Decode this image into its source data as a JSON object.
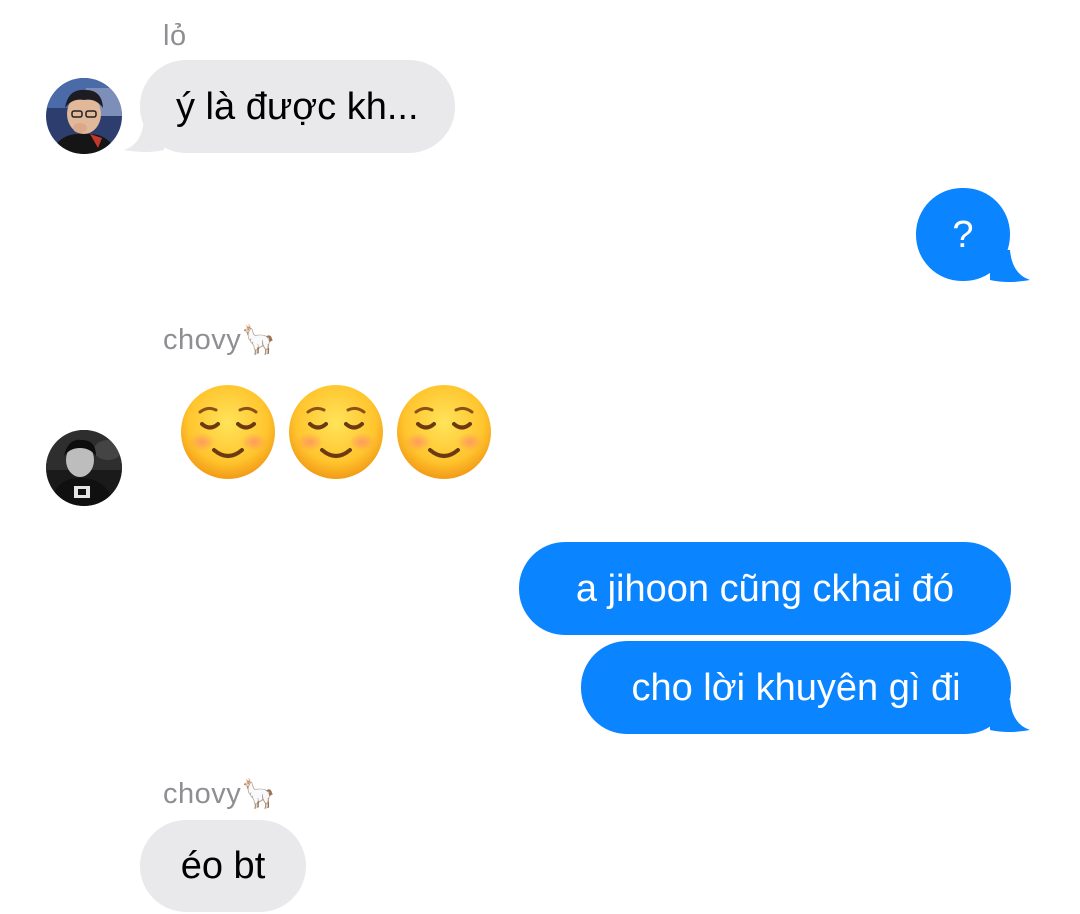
{
  "colors": {
    "incoming_bubble": "#e9e9eb",
    "outgoing_bubble": "#0a84ff",
    "sender_name": "#8e8e93"
  },
  "messages": [
    {
      "direction": "incoming",
      "sender": "lỏ",
      "text": "ý là được kh...",
      "avatar": "avatar-photo-lo"
    },
    {
      "direction": "outgoing",
      "text": "?"
    },
    {
      "direction": "incoming",
      "sender": "chovy",
      "sender_emoji": "🦙",
      "emoji_count": 3,
      "emoji_name": "smiling-face-icon",
      "avatar": "avatar-photo-chovy"
    },
    {
      "direction": "outgoing",
      "text": "a jihoon cũng ckhai đó"
    },
    {
      "direction": "outgoing",
      "text": "cho lời khuyên gì đi"
    },
    {
      "direction": "incoming",
      "sender": "chovy",
      "sender_emoji": "🦙",
      "text": "éo bt"
    }
  ]
}
